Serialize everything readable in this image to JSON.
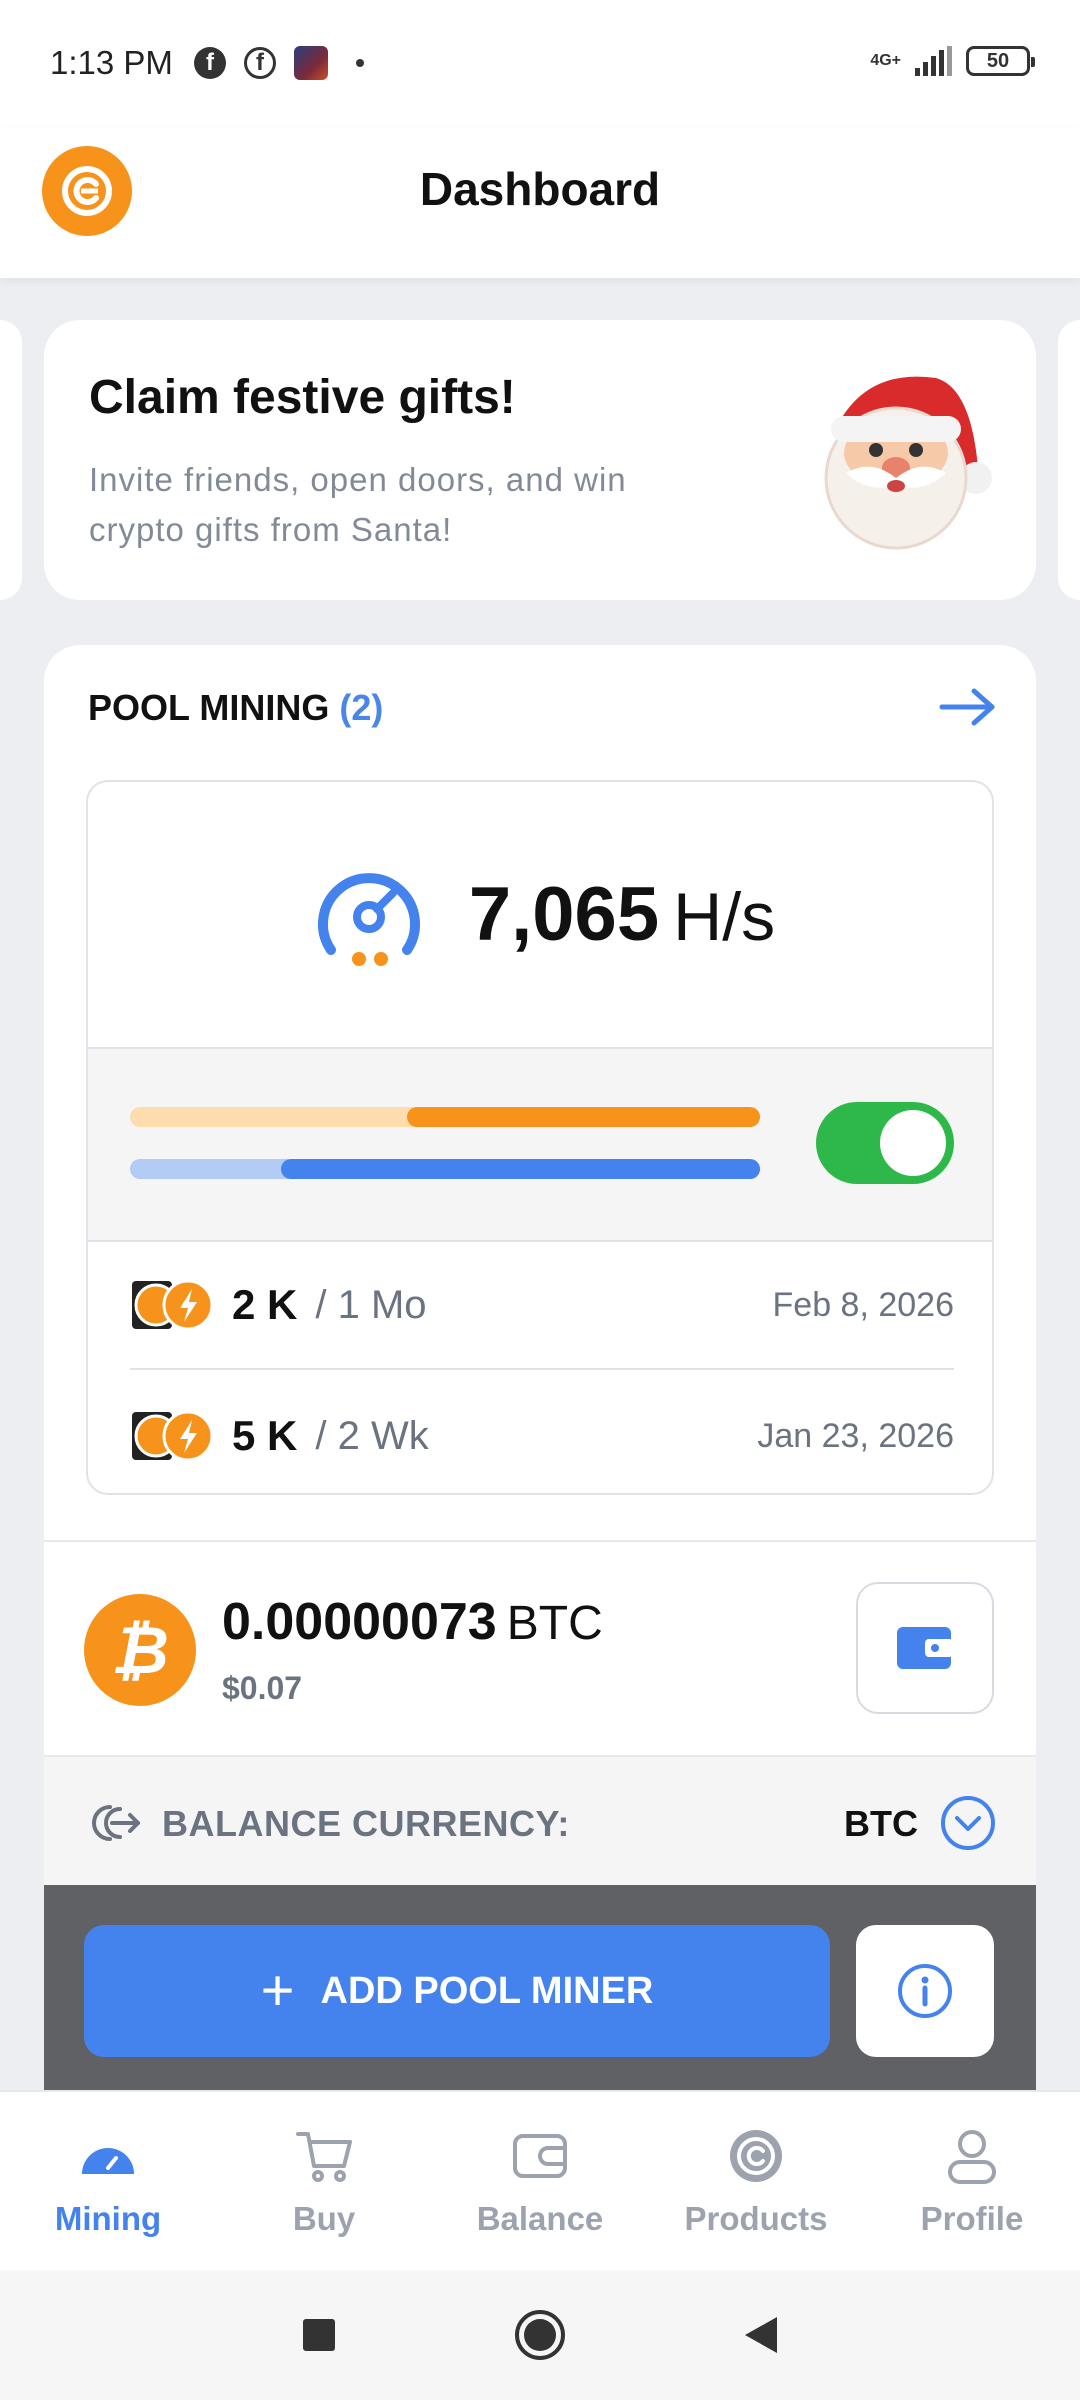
{
  "status_bar": {
    "time": "1:13 PM",
    "network": "4G+",
    "battery": "50"
  },
  "header": {
    "title": "Dashboard",
    "logo_icon": "coin-logo-icon"
  },
  "promo": {
    "title": "Claim festive gifts!",
    "subtitle": "Invite friends, open doors, and win crypto gifts from Santa!",
    "image_icon": "santa-icon"
  },
  "pool": {
    "title": "POOL MINING",
    "count": "(2)",
    "hashrate_value": "7,065",
    "hashrate_unit": "H/s",
    "orange_bar_fill": 0.56,
    "blue_bar_fill": 0.76,
    "mining_enabled": true,
    "plans": [
      {
        "amount": "2 K",
        "period": "/ 1 Mo",
        "date": "Feb 8, 2026"
      },
      {
        "amount": "5 K",
        "period": "/ 2 Wk",
        "date": "Jan 23, 2026"
      }
    ]
  },
  "balance": {
    "amount": "0.00000073",
    "unit": "BTC",
    "usd": "$0.07"
  },
  "currency": {
    "label": "BALANCE CURRENCY:",
    "value": "BTC"
  },
  "actions": {
    "add_miner_label": "ADD POOL MINER"
  },
  "nav": {
    "items": [
      {
        "label": "Mining",
        "active": true
      },
      {
        "label": "Buy",
        "active": false
      },
      {
        "label": "Balance",
        "active": false
      },
      {
        "label": "Products",
        "active": false
      },
      {
        "label": "Profile",
        "active": false
      }
    ]
  },
  "colors": {
    "accent_blue": "#4483ee",
    "bitcoin_orange": "#f7931a",
    "toggle_green": "#2fb84a"
  }
}
